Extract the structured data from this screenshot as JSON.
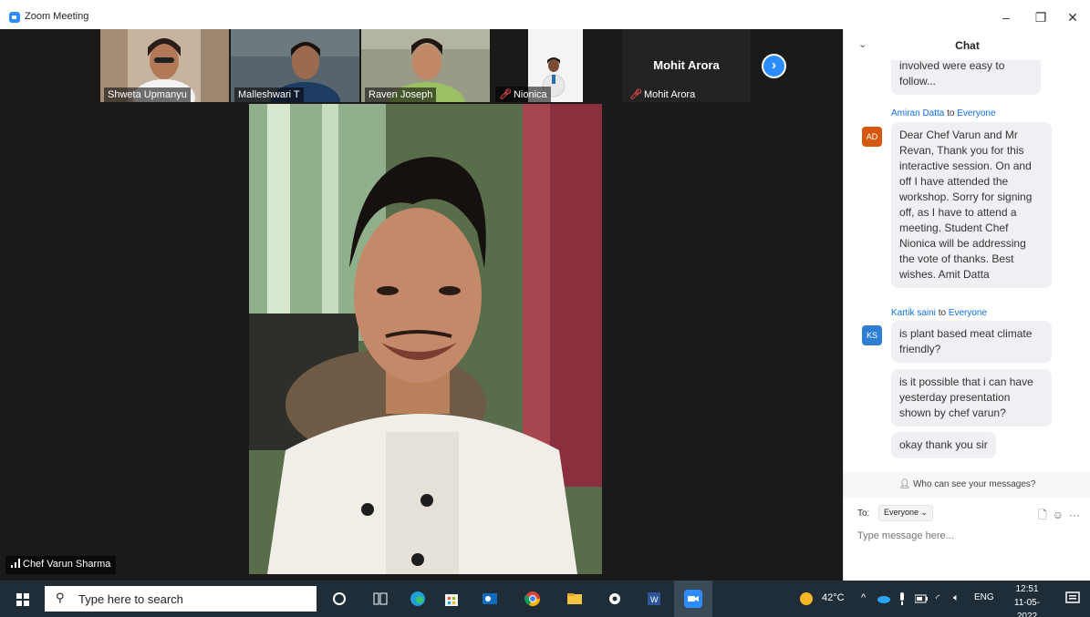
{
  "window": {
    "title": "Zoom Meeting",
    "minimize": "–",
    "maximize": "❐",
    "close": "✕"
  },
  "thumbnails": [
    {
      "name": "Shweta Upmanyu",
      "muted": false
    },
    {
      "name": "Malleshwari T",
      "muted": false
    },
    {
      "name": "Raven Joseph",
      "muted": false
    },
    {
      "name": "Nionica",
      "muted": true
    },
    {
      "name": "Mohit Arora",
      "muted": true,
      "center_name": "Mohit Arora"
    }
  ],
  "next_page_icon": "chevron-right-icon",
  "active_speaker": "Chef Varun Sharma",
  "chat": {
    "title": "Chat",
    "messages": [
      {
        "text_partial": "involved were easy to follow..."
      },
      {
        "sender": "Amiran Datta",
        "to_word": "to",
        "to": "Everyone",
        "initials": "AD",
        "color": "#d4590f",
        "text": "Dear Chef Varun and Mr Revan, Thank you for this interactive session. On and off I have attended the workshop. Sorry for signing off, as I have to attend a meeting. Student Chef Nionica will be addressing the vote of thanks. Best wishes. Amit Datta"
      },
      {
        "sender": "Kartik saini",
        "to_word": "to",
        "to": "Everyone",
        "initials": "KS",
        "color": "#2d7fd3",
        "text": "is plant based meat climate friendly?"
      },
      {
        "text": "is it possible that i can have yesterday presentation shown by chef varun?"
      },
      {
        "text": "okay thank you sir"
      }
    ],
    "who_can_see": "Who can see your messages?",
    "to_label": "To:",
    "to_value": "Everyone ⌄",
    "placeholder": "Type message here..."
  },
  "taskbar": {
    "search_placeholder": "Type here to search",
    "weather": "42°C",
    "language": "ENG",
    "time": "12:51",
    "date": "11-05-2022"
  }
}
